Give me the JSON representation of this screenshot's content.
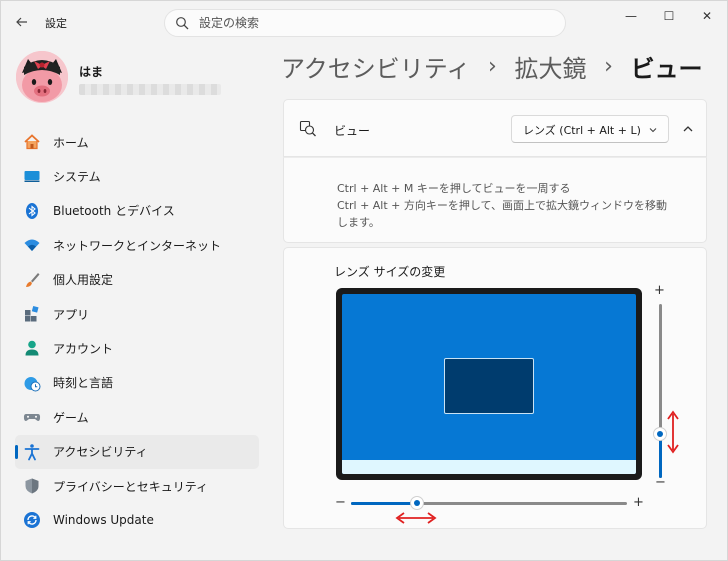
{
  "window": {
    "title": "設定",
    "controls": {
      "minimize": "—",
      "maximize": "☐",
      "close": "✕"
    }
  },
  "search": {
    "placeholder": "設定の検索",
    "value": ""
  },
  "user": {
    "name": "はま"
  },
  "sidebar": {
    "items": [
      {
        "label": "ホーム",
        "icon": "home-icon"
      },
      {
        "label": "システム",
        "icon": "system-icon"
      },
      {
        "label": "Bluetooth とデバイス",
        "icon": "bluetooth-icon"
      },
      {
        "label": "ネットワークとインターネット",
        "icon": "wifi-icon"
      },
      {
        "label": "個人用設定",
        "icon": "brush-icon"
      },
      {
        "label": "アプリ",
        "icon": "apps-icon"
      },
      {
        "label": "アカウント",
        "icon": "account-icon"
      },
      {
        "label": "時刻と言語",
        "icon": "clock-globe-icon"
      },
      {
        "label": "ゲーム",
        "icon": "gamepad-icon"
      },
      {
        "label": "アクセシビリティ",
        "icon": "accessibility-icon",
        "active": true
      },
      {
        "label": "プライバシーとセキュリティ",
        "icon": "shield-icon"
      },
      {
        "label": "Windows Update",
        "icon": "update-icon"
      }
    ]
  },
  "breadcrumb": {
    "items": [
      "アクセシビリティ",
      "拡大鏡"
    ],
    "separator": "›",
    "current": "ビュー"
  },
  "view_setting": {
    "label": "ビュー",
    "dropdown_value": "レンズ (Ctrl + Alt + L)",
    "icon": "magnifier-view-icon",
    "description": [
      "Ctrl + Alt + M キーを押してビューを一周する",
      "Ctrl + Alt + 方向キーを押して、画面上で拡大鏡ウィンドウを移動",
      "します。"
    ]
  },
  "lens_size": {
    "title": "レンズ サイズの変更",
    "width_slider": {
      "minus": "−",
      "plus": "+",
      "value_fraction": 0.24
    },
    "height_slider": {
      "minus": "−",
      "plus": "+",
      "value_fraction": 0.25
    }
  },
  "colors": {
    "accent": "#0067c0",
    "screen": "#0678d4",
    "lens": "#003c6e",
    "annotation_arrow": "#e02020"
  }
}
